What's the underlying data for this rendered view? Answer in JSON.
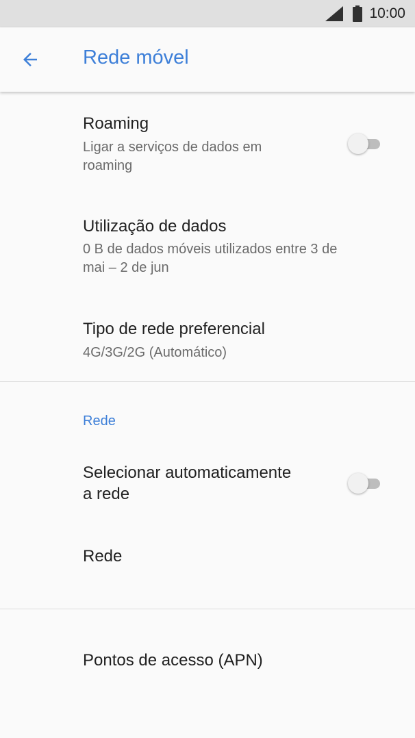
{
  "status_bar": {
    "time": "10:00",
    "icons": [
      "signal-icon",
      "battery-icon"
    ]
  },
  "toolbar": {
    "back_icon": "arrow-back-icon",
    "title": "Rede móvel"
  },
  "settings": {
    "roaming": {
      "title": "Roaming",
      "summary_line1": "Ligar a serviços de dados em",
      "summary_line2": "roaming",
      "enabled": false
    },
    "data_usage": {
      "title": "Utilização de dados",
      "summary_line1": "0 B de dados móveis utilizados entre 3 de",
      "summary_line2": "mai – 2 de jun"
    },
    "network_type": {
      "title": "Tipo de rede preferencial",
      "summary": "4G/3G/2G (Automático)"
    }
  },
  "network_section": {
    "header": "Rede",
    "auto_select": {
      "title_line1": "Selecionar automaticamente",
      "title_line2": "a rede",
      "enabled": false
    },
    "network": {
      "title": "Rede"
    }
  },
  "apn": {
    "title": "Pontos de acesso (APN)"
  },
  "colors": {
    "accent": "#3d7fd8",
    "status_bar": "#e0e0e0",
    "background": "#fafafa"
  }
}
